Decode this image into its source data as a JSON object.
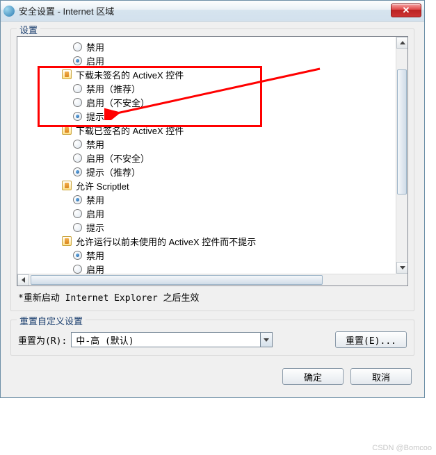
{
  "window": {
    "title": "安全设置 - Internet 区域",
    "close_symbol": "✕"
  },
  "group_settings_label": "设置",
  "tree": {
    "r_disable": "禁用",
    "r_enable": "启用",
    "sec1_title": "下载未签名的 ActiveX 控件",
    "sec1_opt1": "禁用（推荐）",
    "sec1_opt2": "启用（不安全）",
    "sec1_opt3": "提示",
    "sec2_title": "下载已签名的 ActiveX 控件",
    "sec2_opt1": "禁用",
    "sec2_opt2": "启用（不安全）",
    "sec2_opt3": "提示（推荐）",
    "sec3_title": "允许 Scriptlet",
    "sec3_opt1": "禁用",
    "sec3_opt2": "启用",
    "sec3_opt3": "提示",
    "sec4_title": "允许运行以前未使用的 ActiveX 控件而不提示",
    "sec4_opt1": "禁用",
    "sec4_opt2": "启用"
  },
  "note": "*重新启动 Internet Explorer 之后生效",
  "group_reset_label": "重置自定义设置",
  "reset_label": "重置为(R):",
  "reset_value": "中-高 (默认)",
  "reset_button": "重置(E)...",
  "ok_button": "确定",
  "cancel_button": "取消",
  "watermark": "CSDN @Bomcoo"
}
